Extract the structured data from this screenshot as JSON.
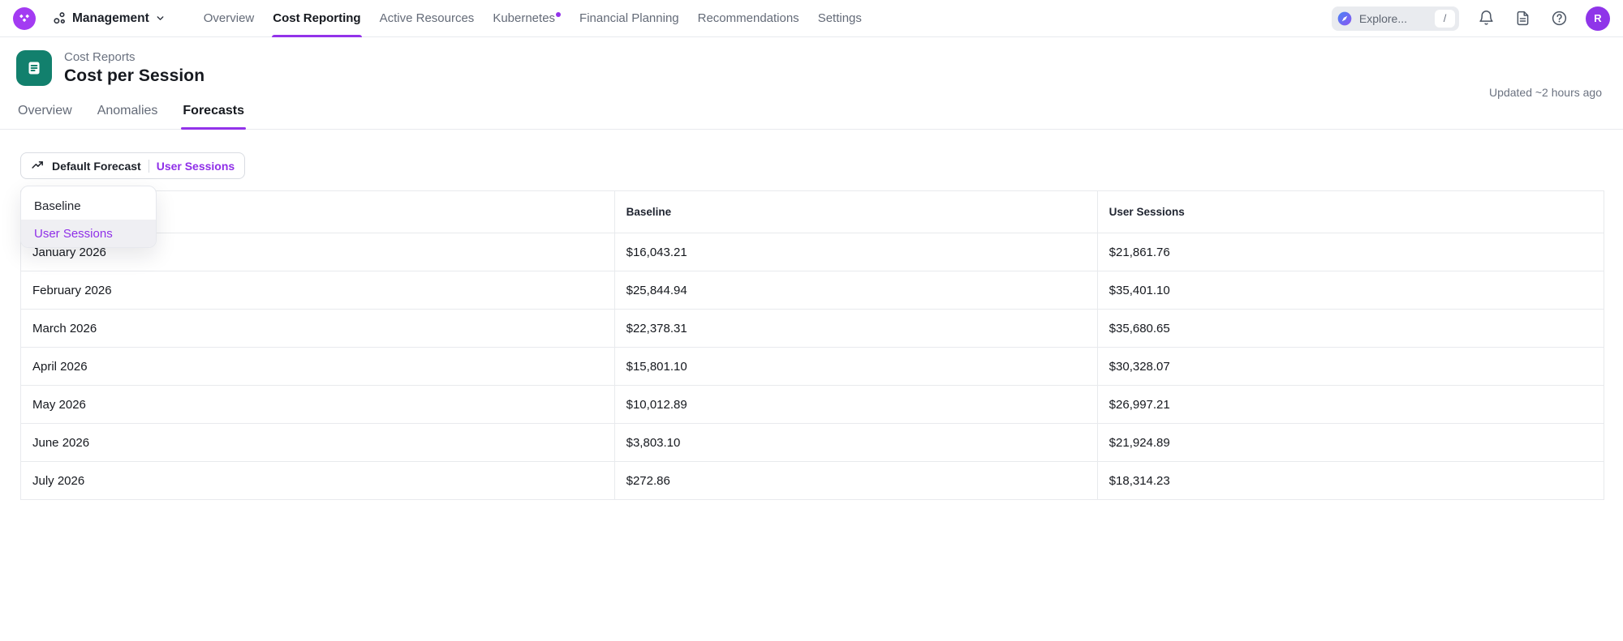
{
  "colors": {
    "accent_purple": "#9333ea",
    "link_purple": "#8f2fe8",
    "logo_purple": "#a33bf2",
    "avatar_purple": "#8f35e9",
    "report_icon_teal": "#12806d"
  },
  "topnav": {
    "workspace_label": "Management",
    "items": [
      {
        "label": "Overview"
      },
      {
        "label": "Cost Reporting"
      },
      {
        "label": "Active Resources"
      },
      {
        "label": "Kubernetes"
      },
      {
        "label": "Financial Planning"
      },
      {
        "label": "Recommendations"
      },
      {
        "label": "Settings"
      }
    ],
    "search": {
      "label": "Explore...",
      "shortcut": "/"
    },
    "avatar_initial": "R"
  },
  "page_header": {
    "breadcrumb": "Cost Reports",
    "title": "Cost per Session",
    "updated": "Updated ~2 hours ago"
  },
  "tabs": [
    {
      "label": "Overview"
    },
    {
      "label": "Anomalies"
    },
    {
      "label": "Forecasts"
    }
  ],
  "toolbar": {
    "forecast_button_label": "Default Forecast",
    "forecast_button_value": "User Sessions"
  },
  "dropdown": {
    "items": [
      {
        "label": "Baseline"
      },
      {
        "label": "User Sessions"
      }
    ]
  },
  "table": {
    "columns": [
      "",
      "Baseline",
      "User Sessions"
    ],
    "rows": [
      {
        "month": "January 2026",
        "baseline": "$16,043.21",
        "user_sessions": "$21,861.76"
      },
      {
        "month": "February 2026",
        "baseline": "$25,844.94",
        "user_sessions": "$35,401.10"
      },
      {
        "month": "March 2026",
        "baseline": "$22,378.31",
        "user_sessions": "$35,680.65"
      },
      {
        "month": "April 2026",
        "baseline": "$15,801.10",
        "user_sessions": "$30,328.07"
      },
      {
        "month": "May 2026",
        "baseline": "$10,012.89",
        "user_sessions": "$26,997.21"
      },
      {
        "month": "June 2026",
        "baseline": "$3,803.10",
        "user_sessions": "$21,924.89"
      },
      {
        "month": "July 2026",
        "baseline": "$272.86",
        "user_sessions": "$18,314.23"
      }
    ]
  }
}
